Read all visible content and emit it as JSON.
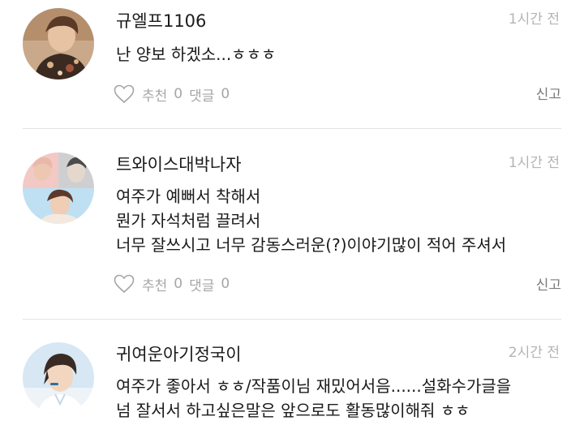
{
  "comments": [
    {
      "username": "규엘프1106",
      "time": "1시간 전",
      "lines": [
        "난 양보 하겠소...ㅎㅎㅎ"
      ],
      "recommend_label": "추천",
      "recommend_count": "0",
      "reply_label": "댓글",
      "reply_count": "0",
      "report_label": "신고"
    },
    {
      "username": "트와이스대박나자",
      "time": "1시간 전",
      "lines": [
        "여주가 예뻐서  착해서",
        "뭔가 자석처럼 끌려서",
        "너무 잘쓰시고 너무 감동스러운(?)이야기많이 적어 주셔서"
      ],
      "recommend_label": "추천",
      "recommend_count": "0",
      "reply_label": "댓글",
      "reply_count": "0",
      "report_label": "신고"
    },
    {
      "username": "귀여운아기정국이",
      "time": "2시간 전",
      "lines": [
        "여주가 좋아서 ㅎㅎ/작품이님 재밌어서음......설화수가글을",
        "넘 잘서서 하고싶은말은 앞으로도 활동많이해줘 ㅎㅎ"
      ]
    }
  ],
  "icons": {
    "like": "heart-outline-icon"
  },
  "colors": {
    "text": "#1a1a1a",
    "meta": "#a6a6a6",
    "timestamp": "#b4b4b4",
    "divider": "#e3e3e3"
  }
}
